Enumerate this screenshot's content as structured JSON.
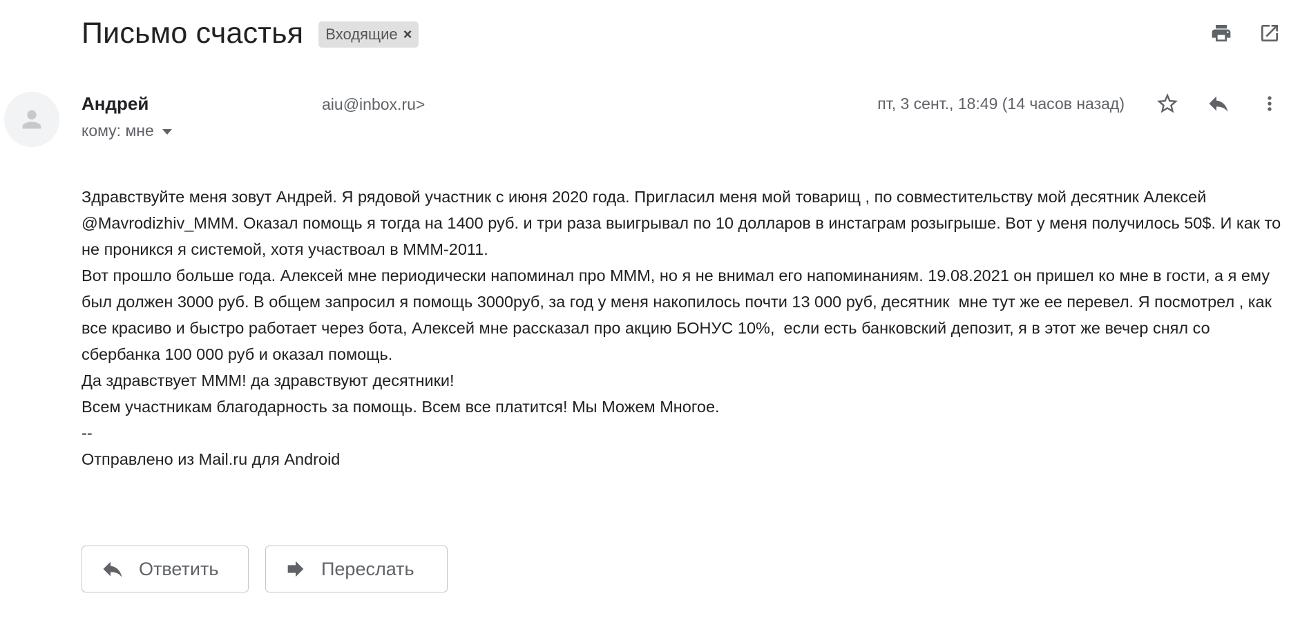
{
  "email": {
    "subject": "Письмо счастья",
    "label": "Входящие",
    "label_remove": "×",
    "sender_name": "Андрей",
    "sender_email": "aiu@inbox.ru>",
    "to": "кому: мне",
    "date": "пт, 3 сент., 18:49 (14 часов назад)"
  },
  "body": {
    "paragraphs": [
      "Здравствуйте меня зовут Андрей. Я рядовой участник с июня 2020 года. Пригласил меня мой товарищ , по совместительству мой десятник Алексей @Mavrodizhiv_MMM. Оказал помощь я тогда на 1400 руб. и три раза выигрывал по 10 долларов в инстаграм розыгрыше. Вот у меня получилось 50$. И как то не проникся я системой, хотя участвоал в МММ-2011.",
      "Вот прошло больше года. Алексей мне периодически напоминал про МММ, но я не внимал его напоминаниям. 19.08.2021 он пришел ко мне в гости, а я ему был должен 3000 руб. В общем запросил я помощь 3000руб, за год у меня накопилось почти 13 000 руб, десятник  мне тут же ее перевел. Я посмотрел , как все красиво и быстро работает через бота, Алексей мне рассказал про акцию БОНУС 10%,  если есть банковский депозит, я в этот же вечер снял со сбербанка 100 000 руб и оказал помощь.",
      "Да здравствует МММ! да здравствуют десятники!",
      "Всем участникам благодарность за помощь. Всем все платится! Мы Можем Многое.",
      "--",
      "Отправлено из Mail.ru для Android"
    ]
  },
  "actions": {
    "reply_label": "Ответить",
    "forward_label": "Переслать"
  },
  "icons": {
    "print": "print-icon",
    "open_new_window": "open-in-new-window-icon",
    "star": "star-icon",
    "reply": "reply-icon",
    "more": "more-vert-icon",
    "avatar": "person-icon",
    "forward": "forward-icon"
  },
  "colors": {
    "text": "#202124",
    "secondary_text": "#5f6368",
    "chip_bg": "#e0e0e0",
    "border": "#c4c7c5"
  }
}
